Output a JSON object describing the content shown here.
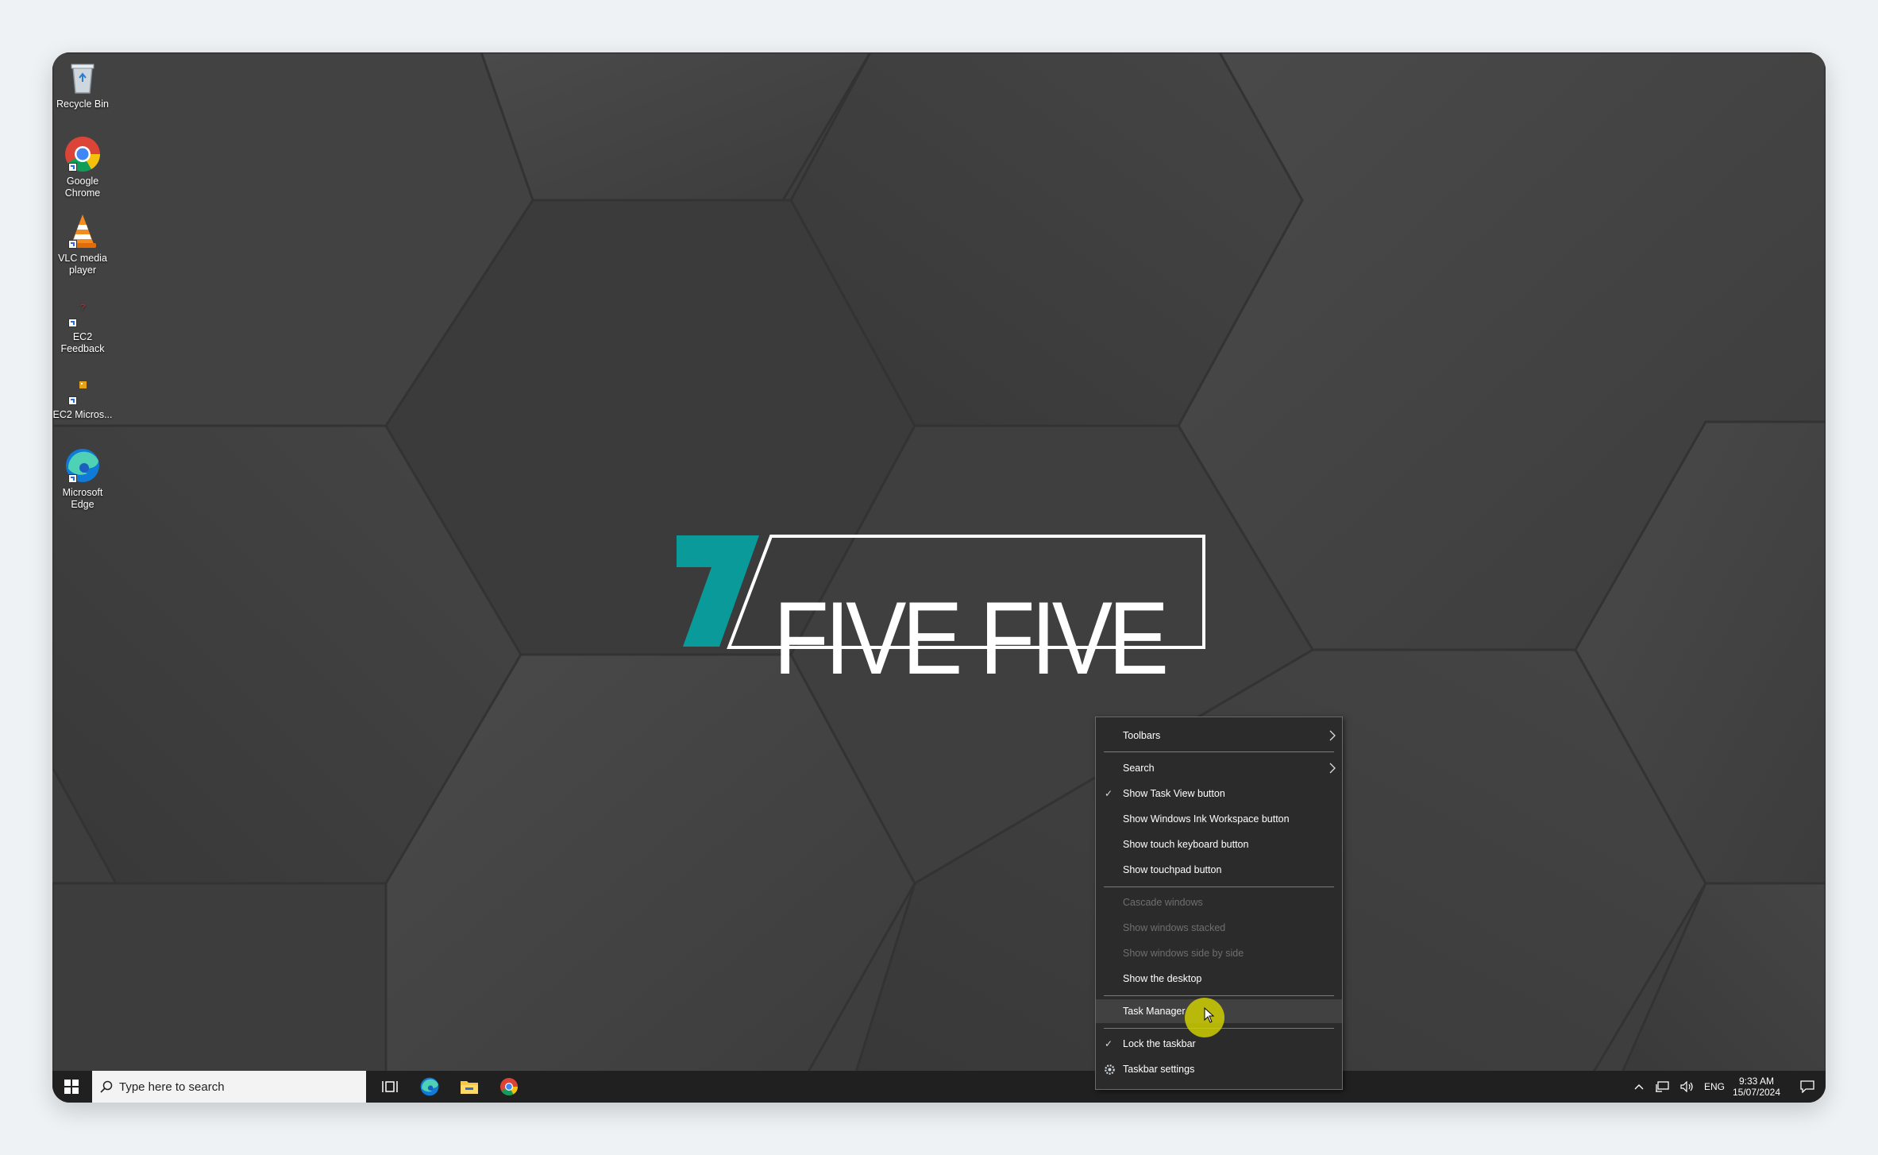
{
  "desktop": {
    "icons": [
      {
        "label": "Recycle Bin",
        "icon": "recycle-bin-icon"
      },
      {
        "label": "Google Chrome",
        "icon": "chrome-icon"
      },
      {
        "label": "VLC media player",
        "icon": "vlc-icon"
      },
      {
        "label": "EC2 Feedback",
        "icon": "ec2-feedback-icon"
      },
      {
        "label": "EC2 Micros...",
        "icon": "ec2-microsoft-icon"
      },
      {
        "label": "Microsoft Edge",
        "icon": "edge-icon"
      }
    ],
    "wallpaper_logo": {
      "mark": "7",
      "text": "FIVE FIVE",
      "accent_color": "#0a9a9a"
    }
  },
  "taskbar": {
    "search_placeholder": "Type here to search",
    "pinned": [
      "task-view-icon",
      "edge-icon",
      "file-explorer-icon",
      "chrome-icon"
    ],
    "tray": {
      "language": "ENG",
      "time": "9:33 AM",
      "date": "15/07/2024"
    }
  },
  "context_menu": {
    "items": [
      {
        "label": "Toolbars",
        "submenu": true
      },
      {
        "label": "Search",
        "submenu": true
      },
      {
        "label": "Show Task View button",
        "checked": true
      },
      {
        "label": "Show Windows Ink Workspace button"
      },
      {
        "label": "Show touch keyboard button"
      },
      {
        "label": "Show touchpad button"
      },
      {
        "label": "Cascade windows",
        "disabled": true
      },
      {
        "label": "Show windows stacked",
        "disabled": true
      },
      {
        "label": "Show windows side by side",
        "disabled": true
      },
      {
        "label": "Show the desktop"
      },
      {
        "label": "Task Manager",
        "hovered": true
      },
      {
        "label": "Lock the taskbar",
        "checked": true
      },
      {
        "label": "Taskbar settings",
        "icon": "gear-icon"
      }
    ]
  },
  "colors": {
    "menu_bg": "#2b2b2b",
    "taskbar_bg": "#202020",
    "cursor_highlight": "#d4d400"
  }
}
